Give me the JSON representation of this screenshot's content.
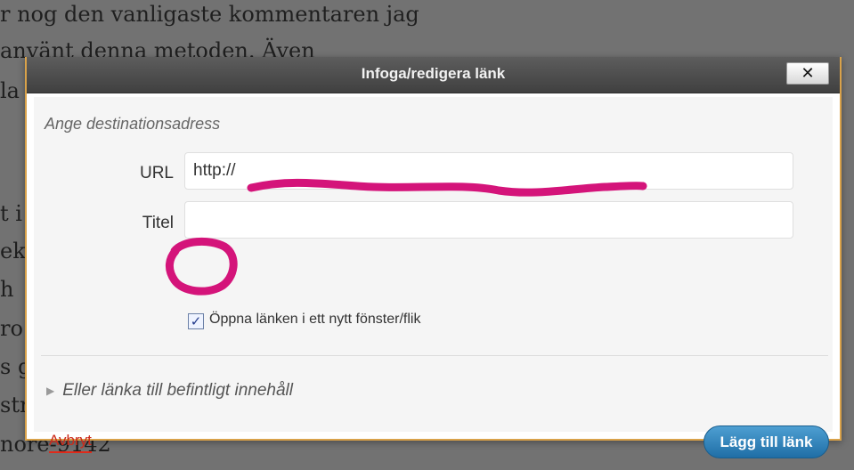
{
  "background": {
    "lines": [
      "r nog den vanligaste kommentaren jag",
      "använt denna metoden. Även",
      "la",
      "t i",
      "ek",
      "h",
      "ro",
      "s g",
      "str",
      "nore-9142"
    ]
  },
  "dialog": {
    "title": "Infoga/redigera länk",
    "close_symbol": "✕",
    "section_title": "Ange destinationsadress",
    "url_label": "URL",
    "url_value": "http://",
    "title_label": "Titel",
    "title_value": "",
    "new_window_checked": true,
    "new_window_label": "Öppna länken i ett nytt fönster/flik",
    "existing_content_toggle": "Eller länka till befintligt innehåll",
    "cancel_label": "Avbryt",
    "submit_label": "Lägg till länk"
  },
  "colors": {
    "overlay": "#727272",
    "dialog_border": "#d9a24a",
    "titlebar": "#4a4a4a",
    "submit_button": "#2a7fb8",
    "cancel_link": "#cc2a1a",
    "annotation": "#d4147a"
  },
  "icons": {
    "close": "close-icon",
    "checkbox": "checkmark-icon",
    "toggle": "triangle-right-icon"
  }
}
